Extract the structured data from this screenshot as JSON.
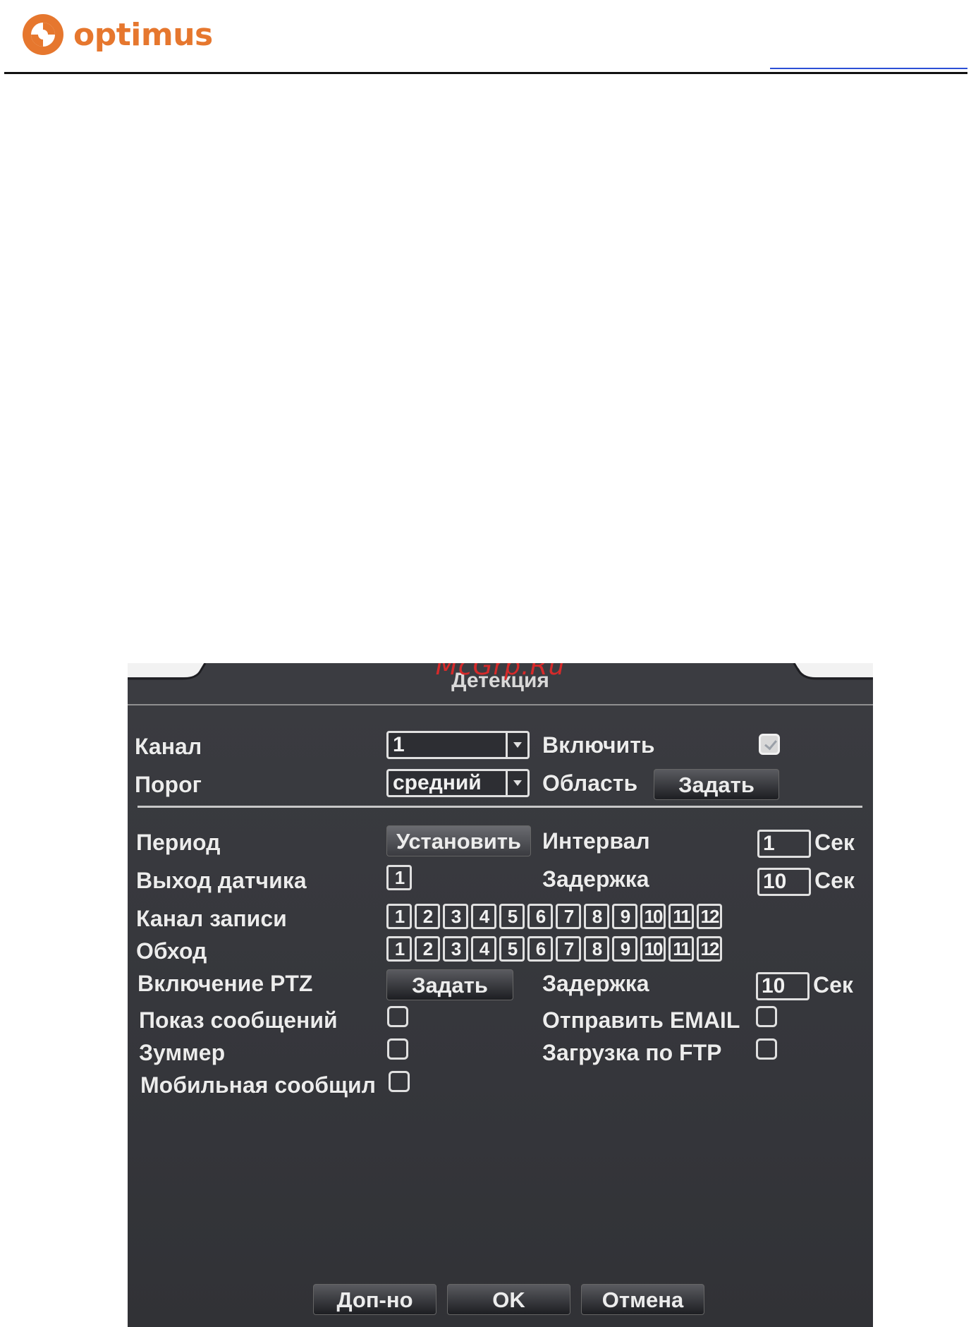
{
  "header": {
    "brand": "optimus",
    "logo_color": "#e6772e"
  },
  "watermark": "McGrp.Ru",
  "dialog": {
    "title": "Детекция",
    "channel_label": "Канал",
    "channel_value": "1",
    "threshold_label": "Порог",
    "threshold_value": "средний",
    "enable_label": "Включить",
    "enable_checked": true,
    "area_label": "Область",
    "area_button": "Задать",
    "period_label": "Период",
    "period_button": "Установить",
    "interval_label": "Интервал",
    "interval_value": "1",
    "interval_unit": "Сек",
    "sensor_out_label": "Выход датчика",
    "sensor_out_value": "1",
    "delay_label": "Задержка",
    "delay_value": "10",
    "delay_unit": "Сек",
    "record_channel_label": "Канал записи",
    "record_channels": [
      "1",
      "2",
      "3",
      "4",
      "5",
      "6",
      "7",
      "8",
      "9",
      "10",
      "11",
      "12"
    ],
    "tour_label": "Обход",
    "tour_channels": [
      "1",
      "2",
      "3",
      "4",
      "5",
      "6",
      "7",
      "8",
      "9",
      "10",
      "11",
      "12"
    ],
    "ptz_label": "Включение PTZ",
    "ptz_button": "Задать",
    "ptz_delay_label": "Задержка",
    "ptz_delay_value": "10",
    "ptz_delay_unit": "Сек",
    "show_msg_label": "Показ сообщений",
    "email_label": "Отправить EMAIL",
    "buzzer_label": "Зуммер",
    "ftp_label": "Загрузка по FTP",
    "mobile_label": "Мобильная сообщил",
    "buttons": {
      "advanced": "Доп-но",
      "ok": "OK",
      "cancel": "Отмена"
    }
  }
}
